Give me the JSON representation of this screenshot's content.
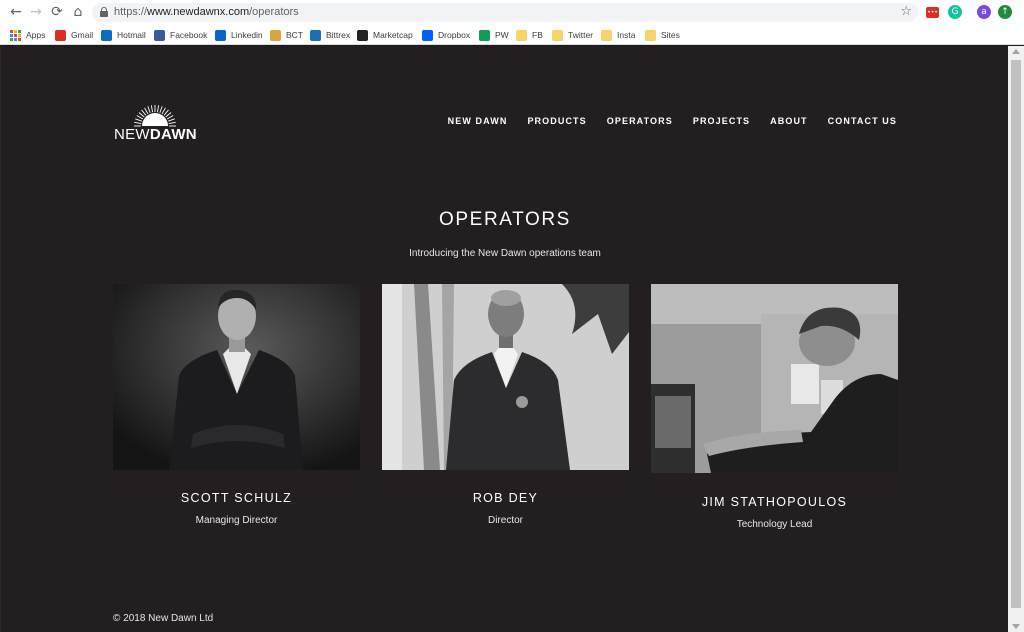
{
  "browser": {
    "url_scheme": "https://",
    "url_host": "www.newdawnx.com",
    "url_path": "/operators",
    "bookmarks": [
      {
        "label": "Apps",
        "icon": "apps-grid-icon"
      },
      {
        "label": "Gmail",
        "icon": "gmail-icon",
        "color": "#d93025"
      },
      {
        "label": "Hotmail",
        "icon": "outlook-icon",
        "color": "#0f6cbd"
      },
      {
        "label": "Facebook",
        "icon": "facebook-icon",
        "color": "#3b5998"
      },
      {
        "label": "Linkedin",
        "icon": "linkedin-icon",
        "color": "#0a66c2"
      },
      {
        "label": "BCT",
        "icon": "bitcoin-icon",
        "color": "#d9a441"
      },
      {
        "label": "Bittrex",
        "icon": "bittrex-icon",
        "color": "#1a6fb5"
      },
      {
        "label": "Marketcap",
        "icon": "marketcap-icon",
        "color": "#222222"
      },
      {
        "label": "Dropbox",
        "icon": "dropbox-icon",
        "color": "#0061fe"
      },
      {
        "label": "PW",
        "icon": "sheets-icon",
        "color": "#0f9d58"
      },
      {
        "label": "FB",
        "icon": "folder-icon",
        "color": "#f6d36b"
      },
      {
        "label": "Twitter",
        "icon": "folder-icon",
        "color": "#f6d36b"
      },
      {
        "label": "Insta",
        "icon": "folder-icon",
        "color": "#f6d36b"
      },
      {
        "label": "Sites",
        "icon": "folder-icon",
        "color": "#f6d36b"
      }
    ],
    "extensions": [
      {
        "icon": "extension-red-icon",
        "glyph": "•••",
        "color": "#d93025"
      },
      {
        "icon": "grammarly-icon",
        "glyph": "G",
        "color": "#15c39a"
      },
      {
        "icon": "profile-avatar-icon",
        "glyph": "a",
        "color": "#7b4bd6"
      },
      {
        "icon": "extension-green-icon",
        "glyph": "↑",
        "color": "#1e8e3e"
      }
    ]
  },
  "site": {
    "logo_left": "NEW",
    "logo_right": "DAWN",
    "menu": [
      "NEW DAWN",
      "PRODUCTS",
      "OPERATORS",
      "PROJECTS",
      "ABOUT",
      "CONTACT US"
    ],
    "title": "OPERATORS",
    "subtitle": "Introducing the New Dawn operations team",
    "operators": [
      {
        "name": "SCOTT SCHULZ",
        "role": "Managing Director"
      },
      {
        "name": "ROB DEY",
        "role": "Director"
      },
      {
        "name": "JIM STATHOPOULOS",
        "role": "Technology Lead"
      }
    ],
    "footer": "© 2018 New Dawn Ltd"
  },
  "colors": {
    "page_bg": "#231f20",
    "text": "#ffffff"
  }
}
